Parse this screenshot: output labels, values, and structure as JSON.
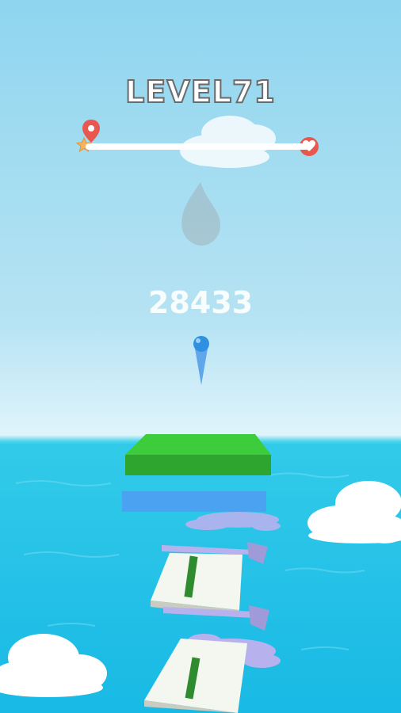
{
  "hud": {
    "level_label": "LEVEL71",
    "score": "28433",
    "progress": 0.0,
    "start_icon": "map-pin-icon",
    "start_badge_icon": "star-icon",
    "goal_icon": "heart-icon"
  },
  "colors": {
    "sky_top": "#8fd5ef",
    "sea": "#16b6e3",
    "platform_top": "#3ccc3c",
    "platform_blue": "#4aa2f0",
    "pin": "#e8584e",
    "ball": "#2f8fe0",
    "splat": "#b7b2ee"
  }
}
